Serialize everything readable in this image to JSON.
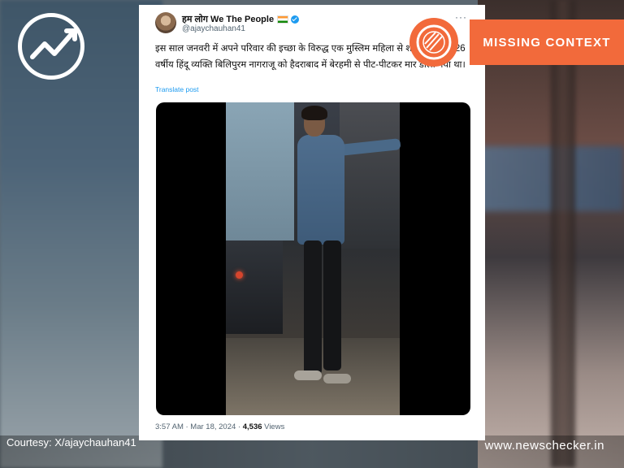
{
  "tweet": {
    "display_name": "हम लोग We The People",
    "handle": "@ajaychauhan41",
    "more": "···",
    "text": "इस साल जनवरी में अपने परिवार की इच्छा के विरुद्ध एक मुस्लिम महिला से शादी करने पर 26 वर्षीय हिंदू व्यक्ति बिलिपुरम नागराजू को हैदराबाद में बेरहमी से पीट-पीटकर मार डाला गया था।",
    "translate": "Translate post",
    "time": "3:57 AM · Mar 18, 2024 · ",
    "views_count": "4,536",
    "views_label": " Views"
  },
  "badge": {
    "label": "MISSING CONTEXT",
    "icon": "fact-check-icon"
  },
  "brand": {
    "logo_icon": "newschecker-logo-icon"
  },
  "footer": {
    "courtesy": "Courtesy: X/ajaychauhan41",
    "site": "www.newschecker.in"
  },
  "colors": {
    "accent": "#f26a3b",
    "link": "#1d9bf0"
  }
}
